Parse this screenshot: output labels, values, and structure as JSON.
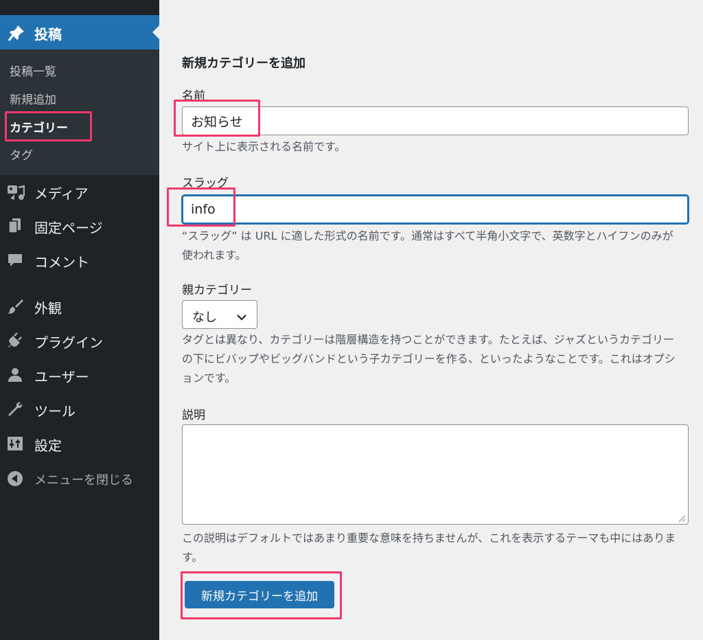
{
  "sidebar": {
    "posts_label": "投稿",
    "submenu": [
      "投稿一覧",
      "新規追加",
      "カテゴリー",
      "タグ"
    ],
    "items": [
      {
        "label": "メディア"
      },
      {
        "label": "固定ページ"
      },
      {
        "label": "コメント"
      },
      {
        "label": "外観"
      },
      {
        "label": "プラグイン"
      },
      {
        "label": "ユーザー"
      },
      {
        "label": "ツール"
      },
      {
        "label": "設定"
      }
    ],
    "collapse_label": "メニューを閉じる"
  },
  "form": {
    "title": "新規カテゴリーを追加",
    "name": {
      "label": "名前",
      "value": "お知らせ",
      "help": "サイト上に表示される名前です。"
    },
    "slug": {
      "label": "スラッグ",
      "value": "info",
      "help": "“スラッグ” は URL に適した形式の名前です。通常はすべて半角小文字で、英数字とハイフンのみが使われます。"
    },
    "parent": {
      "label": "親カテゴリー",
      "selected": "なし",
      "help": "タグとは異なり、カテゴリーは階層構造を持つことができます。たとえば、ジャズというカテゴリーの下にビバップやビッグバンドという子カテゴリーを作る、といったようなことです。これはオプションです。"
    },
    "description": {
      "label": "説明",
      "value": "",
      "help": "この説明はデフォルトではあまり重要な意味を持ちませんが、これを表示するテーマも中にはあります。"
    },
    "submit_label": "新規カテゴリーを追加"
  },
  "colors": {
    "sidebar_bg": "#1d2327",
    "submenu_bg": "#2c3338",
    "accent": "#2271b1",
    "highlight": "#f0386b"
  }
}
